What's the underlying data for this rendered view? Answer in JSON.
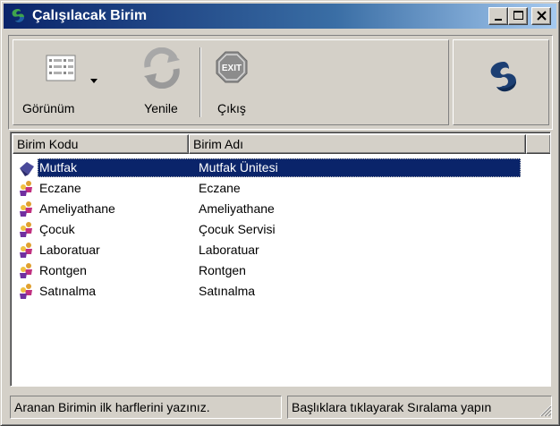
{
  "window": {
    "title": "Çalışılacak Birim"
  },
  "toolbar": {
    "view_label": "Görünüm",
    "refresh_label": "Yenile",
    "exit_label": "Çıkış",
    "exit_icon_text": "EXIT"
  },
  "list": {
    "columns": [
      "Birim Kodu",
      "Birim Adı"
    ],
    "rows": [
      {
        "kod": "Mutfak",
        "ad": "Mutfak Ünitesi",
        "selected": true
      },
      {
        "kod": "Eczane",
        "ad": "Eczane"
      },
      {
        "kod": "Ameliyathane",
        "ad": "Ameliyathane"
      },
      {
        "kod": "Çocuk",
        "ad": "Çocuk Servisi"
      },
      {
        "kod": "Laboratuar",
        "ad": "Laboratuar"
      },
      {
        "kod": "Rontgen",
        "ad": "Rontgen"
      },
      {
        "kod": "Satınalma",
        "ad": "Satınalma"
      }
    ]
  },
  "status": {
    "left": "Aranan Birimin ilk harflerini yazınız.",
    "right": "Başlıklara tıklayarak Sıralama yapın"
  },
  "colors": {
    "title_active": "#0a246a",
    "selection": "#0a246a",
    "face": "#d4d0c8"
  }
}
